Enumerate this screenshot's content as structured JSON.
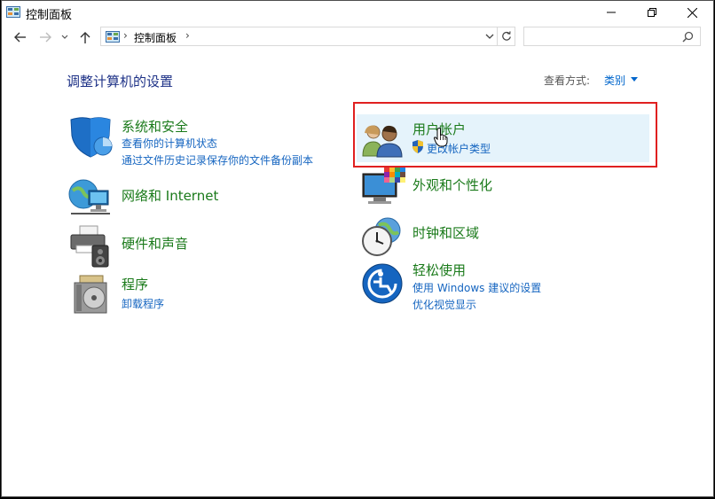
{
  "window": {
    "title": "控制面板",
    "icon": "control-panel-icon",
    "controls": [
      "minimize-icon",
      "maximize-icon",
      "close-icon"
    ]
  },
  "navigation": {
    "back_icon": "back-arrow-icon",
    "forward_icon": "forward-arrow-icon",
    "recent_icon": "chevron-down-icon",
    "up_icon": "up-arrow-icon",
    "breadcrumb": [
      "控制面板"
    ],
    "refresh_icon": "refresh-icon",
    "search": {
      "placeholder": "",
      "value": ""
    }
  },
  "main": {
    "heading": "调整计算机的设置",
    "view_by": {
      "label": "查看方式:",
      "value": "类别"
    },
    "categories": [
      {
        "title": "系统和安全",
        "icon": "shield-icon",
        "links": [
          "查看你的计算机状态",
          "通过文件历史记录保存你的文件备份副本"
        ]
      },
      {
        "title": "网络和 Internet",
        "icon": "network-globe-icon",
        "links": []
      },
      {
        "title": "硬件和声音",
        "icon": "printer-icon",
        "links": []
      },
      {
        "title": "程序",
        "icon": "programs-disc-icon",
        "links": [
          "卸载程序"
        ]
      },
      {
        "title": "用户帐户",
        "icon": "users-icon",
        "links": [
          "更改帐户类型"
        ],
        "link_icon": "uac-shield-icon",
        "hovered": true
      },
      {
        "title": "外观和个性化",
        "icon": "monitor-palette-icon",
        "links": []
      },
      {
        "title": "时钟和区域",
        "icon": "clock-globe-icon",
        "links": []
      },
      {
        "title": "轻松使用",
        "icon": "ease-of-access-icon",
        "links": [
          "使用 Windows 建议的设置",
          "优化视觉显示"
        ]
      }
    ]
  },
  "colors": {
    "category_title": "#1a7a1a",
    "link": "#1565c0",
    "heading": "#1e3287",
    "hover_bg": "#e5f3fb",
    "highlight_border": "#e02020"
  }
}
